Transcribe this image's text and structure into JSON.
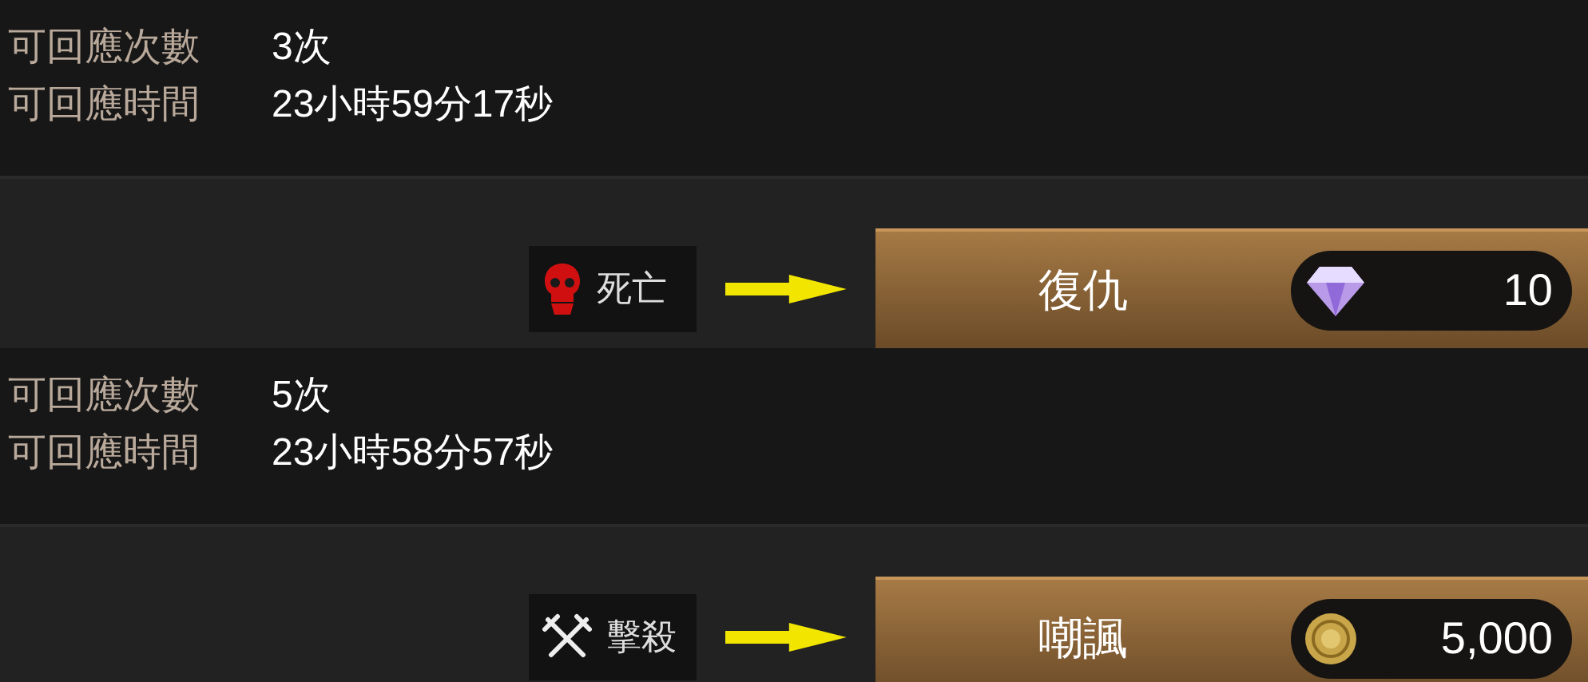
{
  "entries": [
    {
      "info": [
        {
          "label": "可回應次數",
          "value": "3次"
        },
        {
          "label": "可回應時間",
          "value": "23小時59分17秒"
        }
      ],
      "badge": {
        "kind": "skull",
        "label": "死亡"
      },
      "button": {
        "label": "復仇",
        "price": {
          "kind": "gem",
          "amount": "10"
        }
      }
    },
    {
      "info": [
        {
          "label": "可回應次數",
          "value": "5次"
        },
        {
          "label": "可回應時間",
          "value": "23小時58分57秒"
        }
      ],
      "badge": {
        "kind": "swords",
        "label": "擊殺"
      },
      "button": {
        "label": "嘲諷",
        "price": {
          "kind": "coin",
          "amount": "5,000"
        }
      }
    }
  ]
}
